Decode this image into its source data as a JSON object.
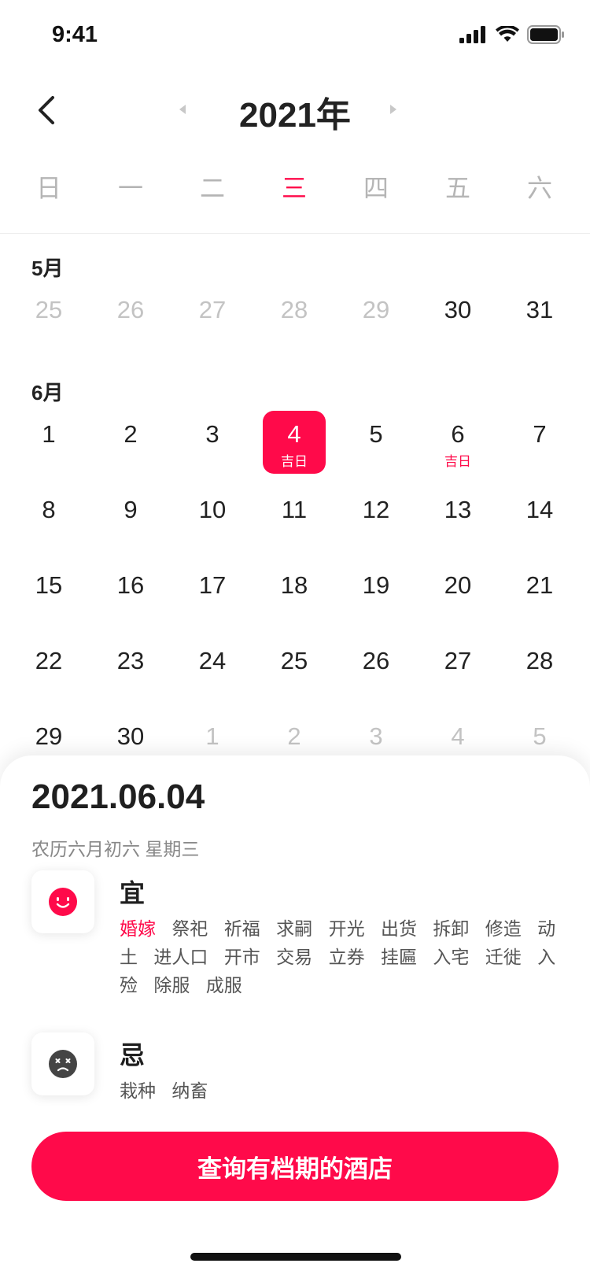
{
  "status_bar": {
    "time": "9:41"
  },
  "header": {
    "year_title": "2021年"
  },
  "weekdays": [
    "日",
    "一",
    "二",
    "三",
    "四",
    "五",
    "六"
  ],
  "calendar": {
    "months": [
      {
        "label": "5月",
        "weeks": [
          [
            {
              "n": "25",
              "faded": true
            },
            {
              "n": "26",
              "faded": true
            },
            {
              "n": "27",
              "faded": true
            },
            {
              "n": "28",
              "faded": true
            },
            {
              "n": "29",
              "faded": true
            },
            {
              "n": "30"
            },
            {
              "n": "31"
            }
          ]
        ]
      },
      {
        "label": "6月",
        "weeks": [
          [
            {
              "n": "1"
            },
            {
              "n": "2"
            },
            {
              "n": "3"
            },
            {
              "n": "4",
              "sub": "吉日",
              "selected": true
            },
            {
              "n": "5"
            },
            {
              "n": "6",
              "sub": "吉日"
            },
            {
              "n": "7"
            }
          ],
          [
            {
              "n": "8"
            },
            {
              "n": "9"
            },
            {
              "n": "10"
            },
            {
              "n": "11"
            },
            {
              "n": "12"
            },
            {
              "n": "13"
            },
            {
              "n": "14"
            }
          ],
          [
            {
              "n": "15"
            },
            {
              "n": "16"
            },
            {
              "n": "17"
            },
            {
              "n": "18"
            },
            {
              "n": "19"
            },
            {
              "n": "20"
            },
            {
              "n": "21"
            }
          ],
          [
            {
              "n": "22"
            },
            {
              "n": "23"
            },
            {
              "n": "24"
            },
            {
              "n": "25"
            },
            {
              "n": "26"
            },
            {
              "n": "27"
            },
            {
              "n": "28"
            }
          ],
          [
            {
              "n": "29"
            },
            {
              "n": "30"
            },
            {
              "n": "1",
              "faded": true
            },
            {
              "n": "2",
              "faded": true
            },
            {
              "n": "3",
              "faded": true
            },
            {
              "n": "4",
              "faded": true
            },
            {
              "n": "5",
              "faded": true
            }
          ]
        ]
      }
    ]
  },
  "detail": {
    "date": "2021.06.04",
    "lunar": "农历六月初六 星期三",
    "yi": {
      "title": "宜",
      "tags": [
        "婚嫁",
        "祭祀",
        "祈福",
        "求嗣",
        "开光",
        "出货",
        "拆卸",
        "修造",
        "动土",
        "进人口",
        "开市",
        "交易",
        "立券",
        "挂匾",
        "入宅",
        "迁徙",
        "入殓",
        "除服",
        "成服"
      ],
      "highlight_index": 0
    },
    "ji": {
      "title": "忌",
      "tags": [
        "栽种",
        "纳畜"
      ]
    },
    "cta_label": "查询有档期的酒店"
  },
  "colors": {
    "accent": "#ff0a4a"
  }
}
